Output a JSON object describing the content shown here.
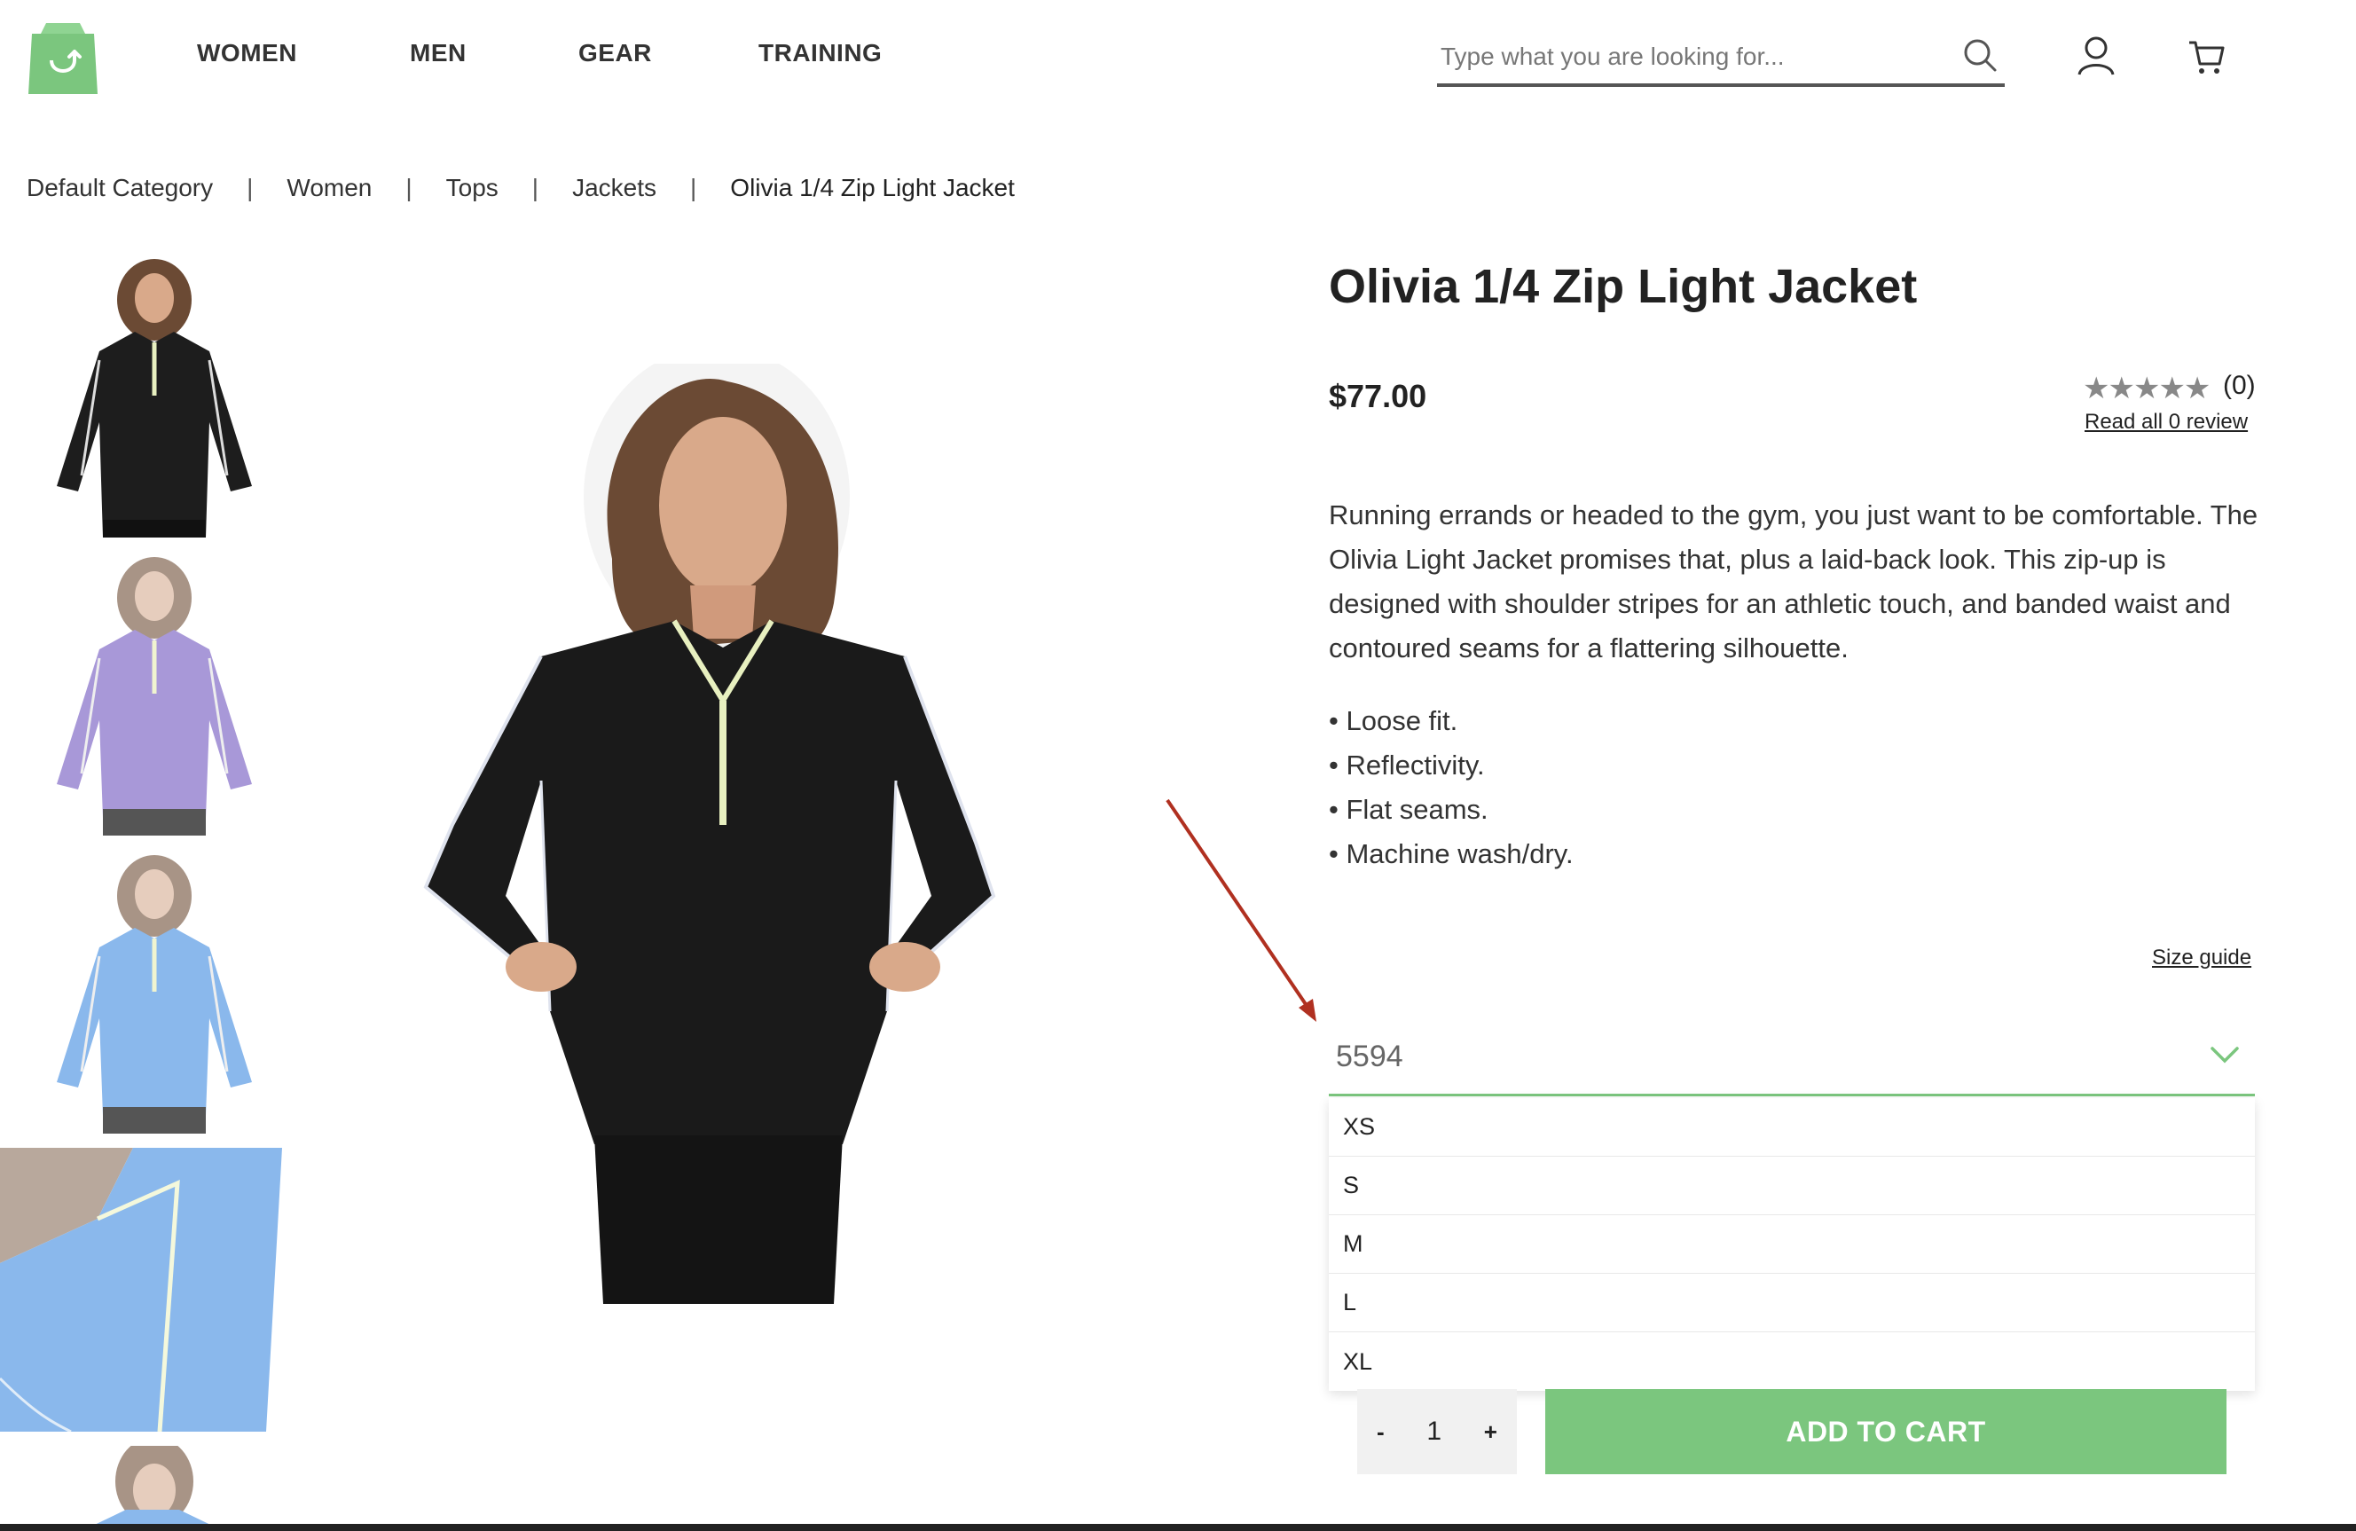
{
  "header": {
    "nav": [
      "WOMEN",
      "MEN",
      "GEAR",
      "TRAINING"
    ],
    "search_placeholder": "Type what you are looking for...",
    "icons": [
      "logo-bag-icon",
      "search-icon",
      "account-icon",
      "cart-icon"
    ],
    "brand_color": "#7bc67e"
  },
  "breadcrumb": [
    "Default Category",
    "Women",
    "Tops",
    "Jackets",
    "Olivia 1/4 Zip Light Jacket"
  ],
  "breadcrumb_separator": "|",
  "thumbnails": [
    {
      "color": "black"
    },
    {
      "color": "purple"
    },
    {
      "color": "blue"
    },
    {
      "color": "blue-detail"
    },
    {
      "color": "blue-partial"
    }
  ],
  "product": {
    "title": "Olivia 1/4 Zip Light Jacket",
    "price": "$77.00",
    "stars": "★★★★★",
    "review_count": "(0)",
    "read_reviews": "Read all 0 review",
    "description": "Running errands or headed to the gym, you just want to be comfortable. The Olivia Light Jacket promises that, plus a laid-back look. This zip-up is designed with shoulder stripes for an athletic touch, and banded waist and contoured seams for a flattering silhouette.",
    "features": [
      "• Loose fit.",
      "• Reflectivity.",
      "• Flat seams.",
      "• Machine wash/dry."
    ],
    "size_guide": "Size guide",
    "size_select": {
      "value": "5594",
      "options": [
        "XS",
        "S",
        "M",
        "L",
        "XL"
      ]
    },
    "quantity": {
      "minus": "-",
      "value": "1",
      "plus": "+"
    },
    "add_to_cart": "ADD TO CART"
  },
  "colors": {
    "accent": "#7bc67e",
    "annotation_arrow": "#b03020"
  }
}
